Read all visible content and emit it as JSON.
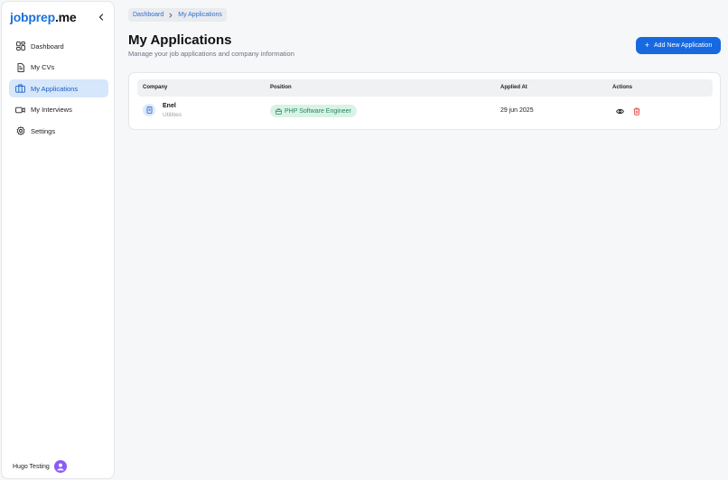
{
  "app": {
    "logo_part1": "jobprep",
    "logo_part2": ".me"
  },
  "sidebar": {
    "items": [
      {
        "label": "Dashboard",
        "icon": "dashboard-icon"
      },
      {
        "label": "My CVs",
        "icon": "document-icon"
      },
      {
        "label": "My Applications",
        "icon": "briefcase-icon",
        "active": true
      },
      {
        "label": "My Interviews",
        "icon": "video-icon"
      },
      {
        "label": "Settings",
        "icon": "gear-icon"
      }
    ],
    "user_name": "Hugo Testing"
  },
  "breadcrumb": {
    "root": "Dashboard",
    "current": "My Applications"
  },
  "page": {
    "title": "My Applications",
    "subtitle": "Manage your job applications and company information",
    "add_button": "Add New Application"
  },
  "table": {
    "headers": {
      "company": "Company",
      "position": "Position",
      "applied": "Applied At",
      "actions": "Actions"
    },
    "rows": [
      {
        "company": "Enel",
        "sector": "Utilities",
        "position": "PHP Software Engineer",
        "applied": "29 jun 2025"
      }
    ]
  },
  "colors": {
    "accent": "#1769e0",
    "active_bg": "#d6e6fb",
    "badge_bg": "#d9f2e8",
    "badge_text": "#1f8a5b",
    "delete": "#e03131",
    "avatar": "#8b5cf6"
  }
}
